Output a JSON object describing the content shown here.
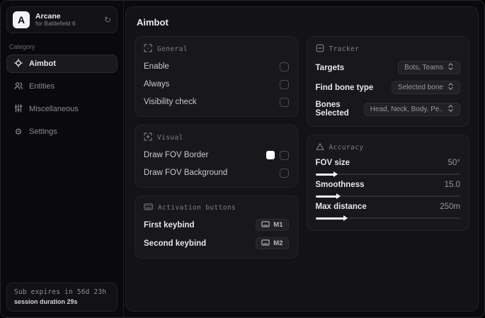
{
  "app": {
    "name": "Arcane",
    "subtitle": "for Battlefield 6",
    "logo_letter": "A"
  },
  "sidebar": {
    "category_label": "Category",
    "items": [
      {
        "label": "Aimbot",
        "icon": "crosshair-icon",
        "selected": true
      },
      {
        "label": "Entities",
        "icon": "users-icon",
        "selected": false
      },
      {
        "label": "Miscellaneous",
        "icon": "sliders-icon",
        "selected": false
      },
      {
        "label": "Settings",
        "icon": "gear-icon",
        "selected": false
      }
    ],
    "footer": {
      "sub_expires": "Sub expires in 56d 23h",
      "session_duration": "session duration 29s"
    }
  },
  "main": {
    "title": "Aimbot",
    "cards": {
      "general": {
        "title": "General",
        "rows": [
          {
            "label": "Enable",
            "checked": false
          },
          {
            "label": "Always",
            "checked": false
          },
          {
            "label": "Visibility check",
            "checked": false
          }
        ]
      },
      "visual": {
        "title": "Visual",
        "rows": [
          {
            "label": "Draw FOV Border",
            "swatch": "#ffffff",
            "checked": false
          },
          {
            "label": "Draw FOV Background",
            "checked": false
          }
        ]
      },
      "activation": {
        "title": "Activation buttons",
        "rows": [
          {
            "label": "First keybind",
            "key": "M1"
          },
          {
            "label": "Second keybind",
            "key": "M2"
          }
        ]
      },
      "tracker": {
        "title": "Tracker",
        "rows": [
          {
            "label": "Targets",
            "value": "Bots, Teams"
          },
          {
            "label": "Find bone type",
            "value": "Selected bone"
          },
          {
            "label": "Bones Selected",
            "value": "Head, Neck, Body, Pe.."
          }
        ]
      },
      "accuracy": {
        "title": "Accuracy",
        "sliders": [
          {
            "label": "FOV size",
            "value": "50°",
            "percent": 13
          },
          {
            "label": "Smoothness",
            "value": "15.0",
            "percent": 15
          },
          {
            "label": "Max distance",
            "value": "250m",
            "percent": 20
          }
        ]
      }
    }
  },
  "icons": {
    "refresh": "↻",
    "gear": "⚙"
  },
  "colors": {
    "background": "#0a0a0c",
    "panel": "#131316",
    "card": "#18181b",
    "accent_fill": "#f5f5f7",
    "fov_border_swatch": "#ffffff"
  }
}
